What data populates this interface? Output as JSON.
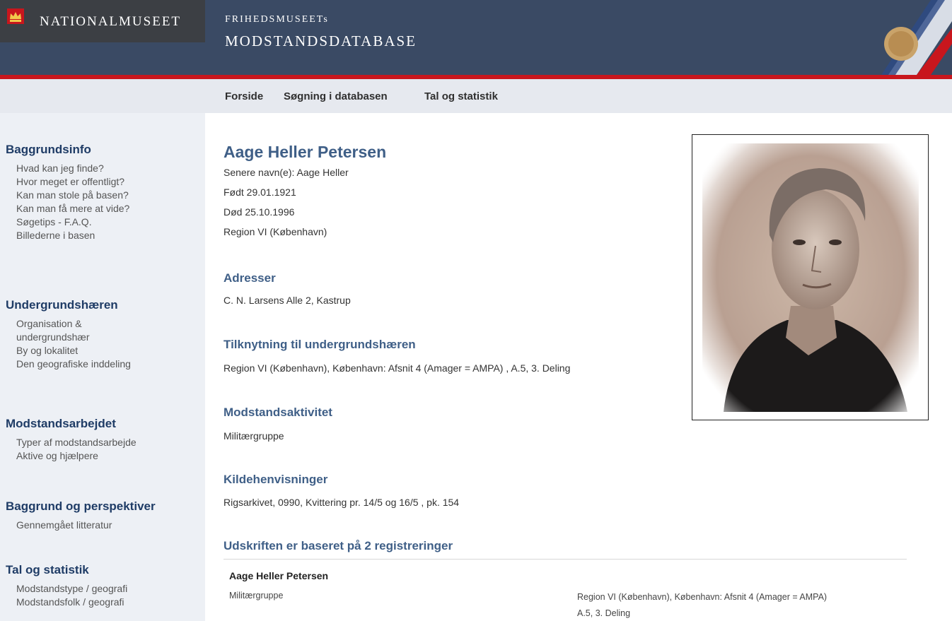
{
  "header": {
    "logo_text": "NATIONALMUSEET",
    "site_title_line1": "FRIHEDSMUSEETs",
    "site_title_line2": "MODSTANDSDATABASE",
    "logo_icon": "crown-icon"
  },
  "nav": {
    "items": [
      "Forside",
      "Søgning i databasen",
      "Tal og statistik"
    ]
  },
  "sidebar": {
    "sections": [
      {
        "heading": "Baggrundsinfo",
        "links": [
          "Hvad kan jeg finde?",
          "Hvor meget er offentligt?",
          "Kan man stole på basen?",
          "Kan man få mere at vide?",
          "Søgetips - F.A.Q.",
          "Billederne i basen"
        ]
      },
      {
        "heading": "Undergrundshæren",
        "links": [
          "Organisation &",
          "undergrundshær",
          "By og lokalitet",
          "Den geografiske inddeling"
        ]
      },
      {
        "heading": "Modstandsarbejdet",
        "links": [
          "Typer af modstandsarbejde",
          "Aktive og hjælpere"
        ]
      },
      {
        "heading": "Baggrund og perspektiver",
        "links": [
          "Gennemgået litteratur"
        ]
      },
      {
        "heading": "Tal og statistik",
        "links": [
          "Modstandstype / geografi",
          "Modstandsfolk / geografi"
        ]
      }
    ]
  },
  "person": {
    "name": "Aage Heller Petersen",
    "later_names": "Senere navn(e): Aage Heller",
    "born": "Født 29.01.1921",
    "died": "Død 25.10.1996",
    "region": "Region VI (København)"
  },
  "sections": {
    "addresses_heading": "Adresser",
    "addresses_text": "C. N. Larsens Alle 2, Kastrup",
    "affiliation_heading": "Tilknytning til undergrundshæren",
    "affiliation_text": "Region VI (København), København: Afsnit 4 (Amager = AMPA) , A.5, 3. Deling",
    "activity_heading": "Modstandsaktivitet",
    "activity_text": "Militærgruppe",
    "sources_heading": "Kildehenvisninger",
    "sources_text": "Rigsarkivet, 0990, Kvittering pr. 14/5 og 16/5 , pk. 154",
    "registrations_heading": "Udskriften er baseret på 2 registreringer"
  },
  "registration": {
    "name": "Aage Heller Petersen",
    "activity": "Militærgruppe",
    "affiliation_line1": "Region VI (København), København: Afsnit 4 (Amager = AMPA)",
    "affiliation_line2": "A.5, 3. Deling"
  },
  "colors": {
    "header_bg": "#3a4a64",
    "accent_red": "#c8161d",
    "heading_blue": "#3f5f87",
    "sidebar_bg": "#edf0f5"
  }
}
